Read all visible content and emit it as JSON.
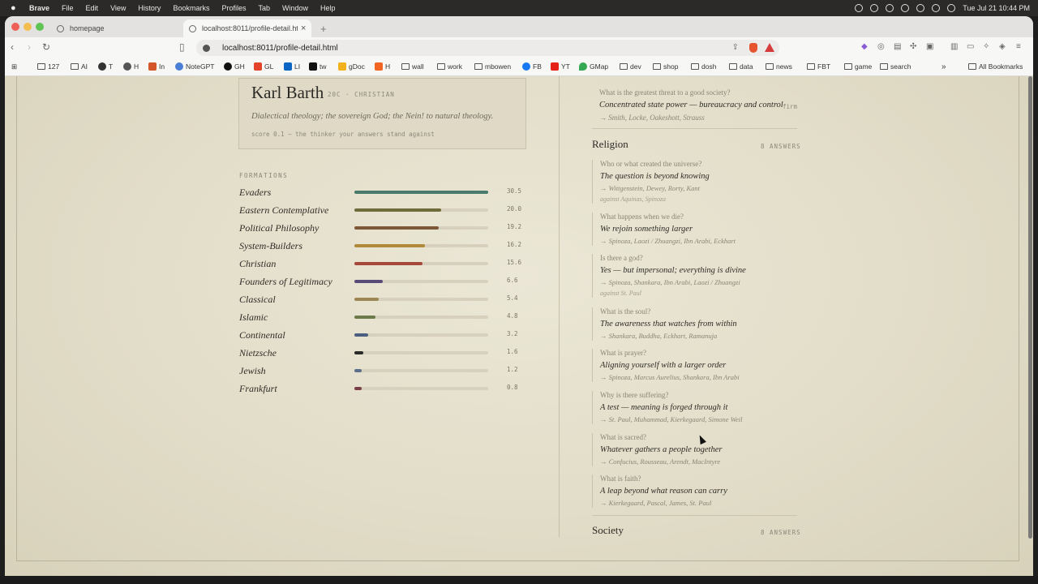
{
  "menubar": {
    "app": "Brave",
    "items": [
      "File",
      "Edit",
      "View",
      "History",
      "Bookmarks",
      "Profiles",
      "Tab",
      "Window",
      "Help"
    ],
    "clock": "Tue Jul 21  10:44 PM"
  },
  "browser": {
    "tabs": [
      {
        "title": "homepage"
      },
      {
        "title": "localhost:8011/profile-detail.ht"
      }
    ],
    "new_tab": "+",
    "close_tab": "×",
    "url": "localhost:8011/profile-detail.html",
    "bookmarks": [
      "127",
      "AI",
      "T",
      "H",
      "In",
      "NoteGPT",
      "GH",
      "GL",
      "LI",
      "tw",
      "gDoc",
      "H",
      "wall",
      "work",
      "mbowen",
      "FB",
      "YT",
      "GMap",
      "dev",
      "shop",
      "dosh",
      "data",
      "news",
      "FBT",
      "game",
      "search"
    ],
    "more": "»",
    "all_bookmarks": "All Bookmarks"
  },
  "profile": {
    "name": "Karl Barth",
    "meta": "20C · CHRISTIAN",
    "description": "Dialectical theology; the sovereign God; the Nein! to natural theology.",
    "score": "score 0.1 — the thinker your answers stand against"
  },
  "formations": {
    "header": "FORMATIONS",
    "items": [
      {
        "name": "Evaders",
        "value": "30.5",
        "fraction": 1.0,
        "color": "#4a7a6c"
      },
      {
        "name": "Eastern Contemplative",
        "value": "20.0",
        "fraction": 0.65,
        "color": "#6f6b3a"
      },
      {
        "name": "Political Philosophy",
        "value": "19.2",
        "fraction": 0.63,
        "color": "#7c5838"
      },
      {
        "name": "System-Builders",
        "value": "16.2",
        "fraction": 0.53,
        "color": "#b08a3a"
      },
      {
        "name": "Christian",
        "value": "15.6",
        "fraction": 0.51,
        "color": "#a6483a"
      },
      {
        "name": "Founders of Legitimacy",
        "value": "6.6",
        "fraction": 0.21,
        "color": "#574c78"
      },
      {
        "name": "Classical",
        "value": "5.4",
        "fraction": 0.18,
        "color": "#9c8652"
      },
      {
        "name": "Islamic",
        "value": "4.8",
        "fraction": 0.16,
        "color": "#6b7a4a"
      },
      {
        "name": "Continental",
        "value": "3.2",
        "fraction": 0.105,
        "color": "#4d5f80"
      },
      {
        "name": "Nietzsche",
        "value": "1.6",
        "fraction": 0.065,
        "color": "#2a2a26"
      },
      {
        "name": "Jewish",
        "value": "1.2",
        "fraction": 0.055,
        "color": "#5b6f8c"
      },
      {
        "name": "Frankfurt",
        "value": "0.8",
        "fraction": 0.055,
        "color": "#7a3f48"
      }
    ]
  },
  "answers": {
    "top": {
      "question": "What is the greatest threat to a good society?",
      "answer": "Concentrated state power — bureaucracy and control",
      "with": "→ Smith, Locke, Oakeshott, Strauss",
      "tag": "firm"
    },
    "religion": {
      "title": "Religion",
      "count": "8 ANSWERS",
      "items": [
        {
          "q": "Who or what created the universe?",
          "a": "The question is beyond knowing",
          "w": "→ Wittgenstein, Dewey, Rorty, Kant",
          "against": "against Aquinas, Spinoza"
        },
        {
          "q": "What happens when we die?",
          "a": "We rejoin something larger",
          "w": "→ Spinoza, Laozi / Zhuangzi, Ibn Arabi, Eckhart",
          "against": ""
        },
        {
          "q": "Is there a god?",
          "a": "Yes — but impersonal; everything is divine",
          "w": "→ Spinoza, Shankara, Ibn Arabi, Laozi / Zhuangzi",
          "against": "against St. Paul"
        },
        {
          "q": "What is the soul?",
          "a": "The awareness that watches from within",
          "w": "→ Shankara, Buddha, Eckhart, Ramanuja",
          "against": ""
        },
        {
          "q": "What is prayer?",
          "a": "Aligning yourself with a larger order",
          "w": "→ Spinoza, Marcus Aurelius, Shankara, Ibn Arabi",
          "against": ""
        },
        {
          "q": "Why is there suffering?",
          "a": "A test — meaning is forged through it",
          "w": "→ St. Paul, Muhammad, Kierkegaard, Simone Weil",
          "against": ""
        },
        {
          "q": "What is sacred?",
          "a": "Whatever gathers a people together",
          "w": "→ Confucius, Rousseau, Arendt, MacIntyre",
          "against": ""
        },
        {
          "q": "What is faith?",
          "a": "A leap beyond what reason can carry",
          "w": "→ Kierkegaard, Pascal, James, St. Paul",
          "against": ""
        }
      ]
    },
    "society": {
      "title": "Society",
      "count": "8 ANSWERS"
    }
  }
}
